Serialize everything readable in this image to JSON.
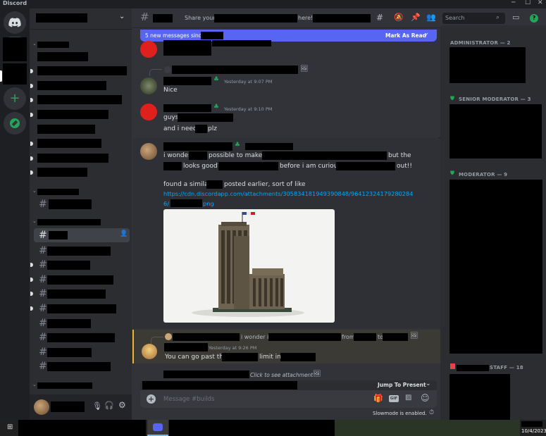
{
  "app": {
    "title": "Discord"
  },
  "header": {
    "share_prefix": "Share your",
    "share_mid": "here!",
    "search_placeholder": "Search"
  },
  "banner": {
    "text": "5 new messages since",
    "action": "Mark As Read"
  },
  "messages": [
    {
      "id": "m2",
      "timestamp": "Yesterday at 9:07 PM",
      "text": "Nice"
    },
    {
      "id": "m3",
      "timestamp": "Yesterday at 9:10 PM",
      "line1": "guys",
      "line2_a": "and i need",
      "line2_b": "plz"
    },
    {
      "id": "m4",
      "l1_a": "i wonder",
      "l1_b": "possible to make a",
      "l1_c": "but the",
      "l2_a": "looks good?",
      "l2_b": "before i am curious",
      "l2_c": "out!!",
      "l3_a": "found a similar",
      "l3_b": "posted earlier, sort of like",
      "link1": "https://cdn.discordapp.com/attachments/305834181949390848/96412324179280284",
      "link2_a": "6/",
      "link2_b": "png"
    },
    {
      "id": "m5",
      "reply_a": "i wonder if",
      "reply_b": "from",
      "reply_c": "to",
      "timestamp": "Yesterday at 9:26 PM",
      "text_a": "You can go past the",
      "text_b": "limit in"
    },
    {
      "id": "m6",
      "attachment_text": "Click to see attachment"
    }
  ],
  "composer": {
    "jump": "Jump To Present",
    "placeholder": "Message #builds",
    "slowmode": "Slowmode is enabled."
  },
  "members": {
    "admin": "ADMINISTRATOR — 2",
    "senior": "SENIOR MODERATOR — 3",
    "mod": "MODERATOR — 9",
    "staff": "STAFF — 18"
  },
  "taskbar": {
    "date": "10/4/2023"
  },
  "colors": {
    "blurple": "#5865f2",
    "green": "#23a55a",
    "link": "#00a8fc"
  }
}
